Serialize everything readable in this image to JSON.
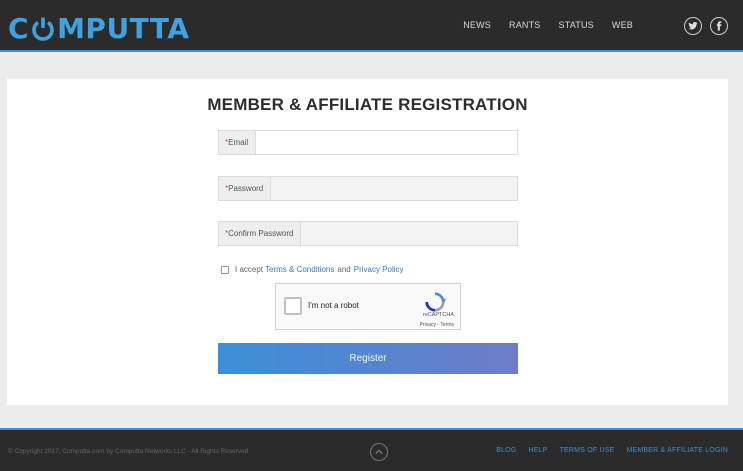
{
  "header": {
    "logo_pre": "C",
    "logo_post": "MPUTTA",
    "nav": [
      {
        "label": "NEWS"
      },
      {
        "label": "RANTS"
      },
      {
        "label": "STATUS"
      },
      {
        "label": "WEB"
      }
    ],
    "social": [
      {
        "icon": "twitter-icon"
      },
      {
        "icon": "facebook-icon"
      }
    ]
  },
  "main": {
    "title": "MEMBER & AFFILIATE REGISTRATION",
    "fields": {
      "email": {
        "required_mark": "*",
        "label": "Email",
        "value": ""
      },
      "password": {
        "required_mark": "*",
        "label": "Password",
        "value": ""
      },
      "confirm": {
        "required_mark": "*",
        "label": "Confirm Password",
        "value": ""
      }
    },
    "terms": {
      "prefix": "I accept",
      "terms_link": "Terms & Conditions",
      "and": "and",
      "privacy_link": "Privacy Policy",
      "checked": false
    },
    "captcha": {
      "label": "I'm not a robot",
      "brand": "reCAPTCHA",
      "links": "Privacy - Terms"
    },
    "register_label": "Register"
  },
  "footer": {
    "copyright": "© Copyright 2017, Computta.com by Computta Networks LLC - All Rights Reserved",
    "links": [
      {
        "label": "BLOG"
      },
      {
        "label": "HELP"
      },
      {
        "label": "TERMS OF USE"
      },
      {
        "label": "MEMBER & AFFILIATE LOGIN"
      }
    ]
  },
  "colors": {
    "accent": "#3d8fd4",
    "header_bg": "#2b2b2b",
    "button_start": "#3a8fd6",
    "button_end": "#6f7cc9",
    "required": "#d9534f"
  }
}
